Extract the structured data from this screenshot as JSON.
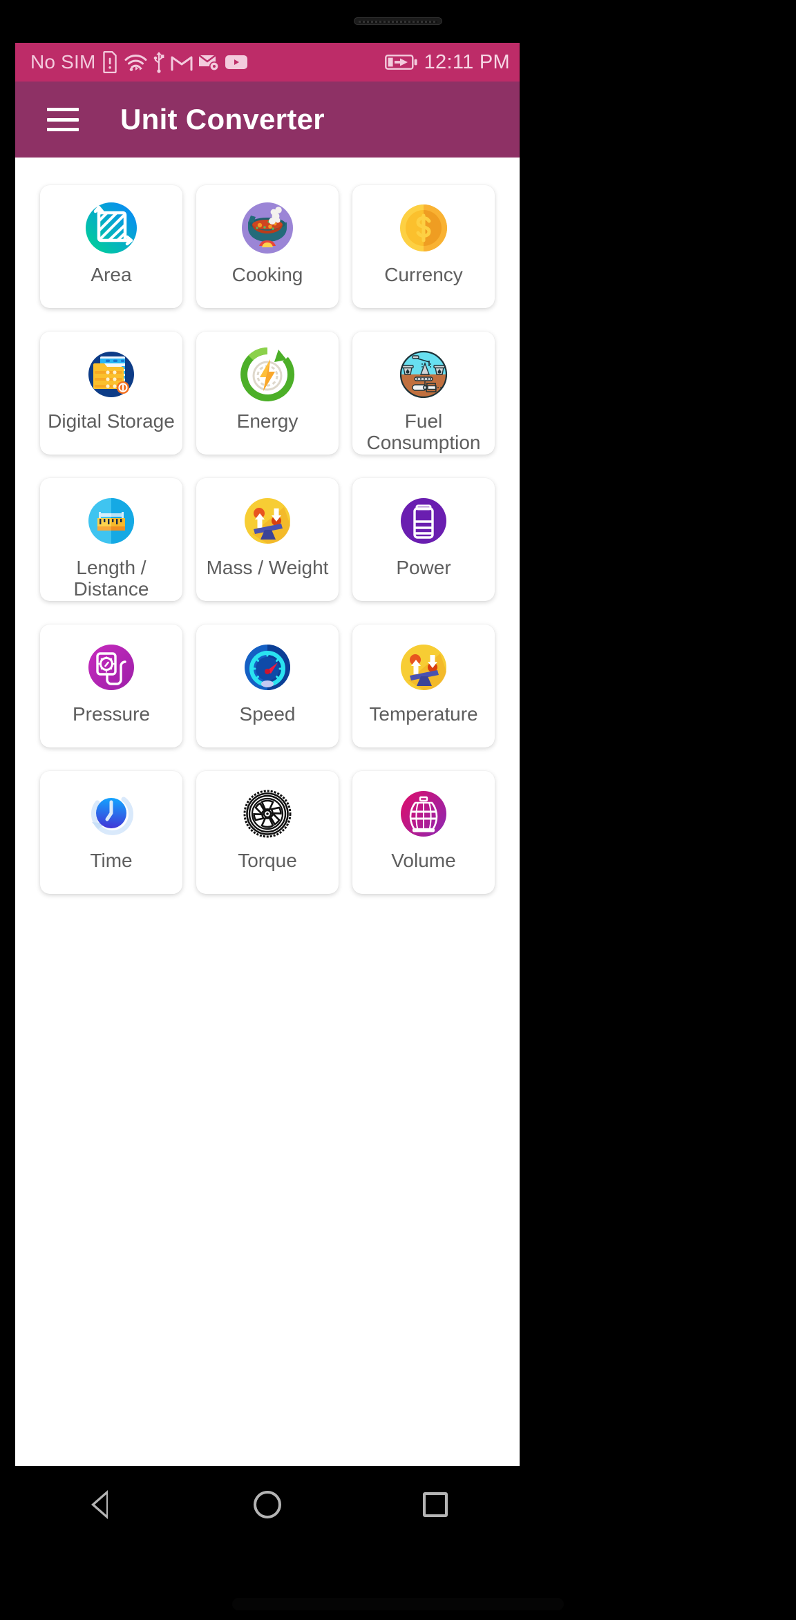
{
  "status_bar": {
    "carrier": "No SIM",
    "time": "12:11 PM",
    "icons": [
      "sim-card-alert-icon",
      "wifi-icon",
      "usb-icon",
      "gmail-icon",
      "email-settings-icon",
      "youtube-icon"
    ],
    "battery_icon": "battery-charging-icon",
    "background_color": "#bd2c68",
    "text_color": "#f3cbdd"
  },
  "app_bar": {
    "menu_icon": "hamburger-menu-icon",
    "title": "Unit Converter",
    "background_color": "#8e3165",
    "title_color": "#ffffff"
  },
  "grid": {
    "label_color": "#5e5e5e",
    "items": [
      {
        "label": "Area",
        "icon": "area-icon",
        "color": "#00c389"
      },
      {
        "label": "Cooking",
        "icon": "cooking-pot-icon",
        "color": "#9b85d6"
      },
      {
        "label": "Currency",
        "icon": "currency-coin-icon",
        "color": "#fbc02d"
      },
      {
        "label": "Digital Storage",
        "icon": "digital-storage-icon",
        "color": "#0d3c87"
      },
      {
        "label": "Energy",
        "icon": "energy-bolt-icon",
        "color": "#4caf28"
      },
      {
        "label": "Fuel Consumption",
        "icon": "fuel-pump-jack-icon",
        "color": "#c0703f"
      },
      {
        "label": "Length / Distance",
        "icon": "ruler-icon",
        "color": "#27b0ec"
      },
      {
        "label": "Mass / Weight",
        "icon": "balance-scale-icon",
        "color": "#f5c024"
      },
      {
        "label": "Power",
        "icon": "battery-icon",
        "color": "#6a1eb0"
      },
      {
        "label": "Pressure",
        "icon": "pressure-gauge-icon",
        "color": "#b426b4"
      },
      {
        "label": "Speed",
        "icon": "speedometer-icon",
        "color": "#0b48b0"
      },
      {
        "label": "Temperature",
        "icon": "balance-scale-icon",
        "color": "#f5c024"
      },
      {
        "label": "Time",
        "icon": "clock-refresh-icon",
        "color": "#2979ff"
      },
      {
        "label": "Torque",
        "icon": "tire-wheel-icon",
        "color": "#111111"
      },
      {
        "label": "Volume",
        "icon": "barrel-icon",
        "color": "#c2187e"
      }
    ]
  },
  "nav_bar": {
    "back": "back-triangle-icon",
    "home": "home-circle-icon",
    "recents": "recents-square-icon"
  }
}
